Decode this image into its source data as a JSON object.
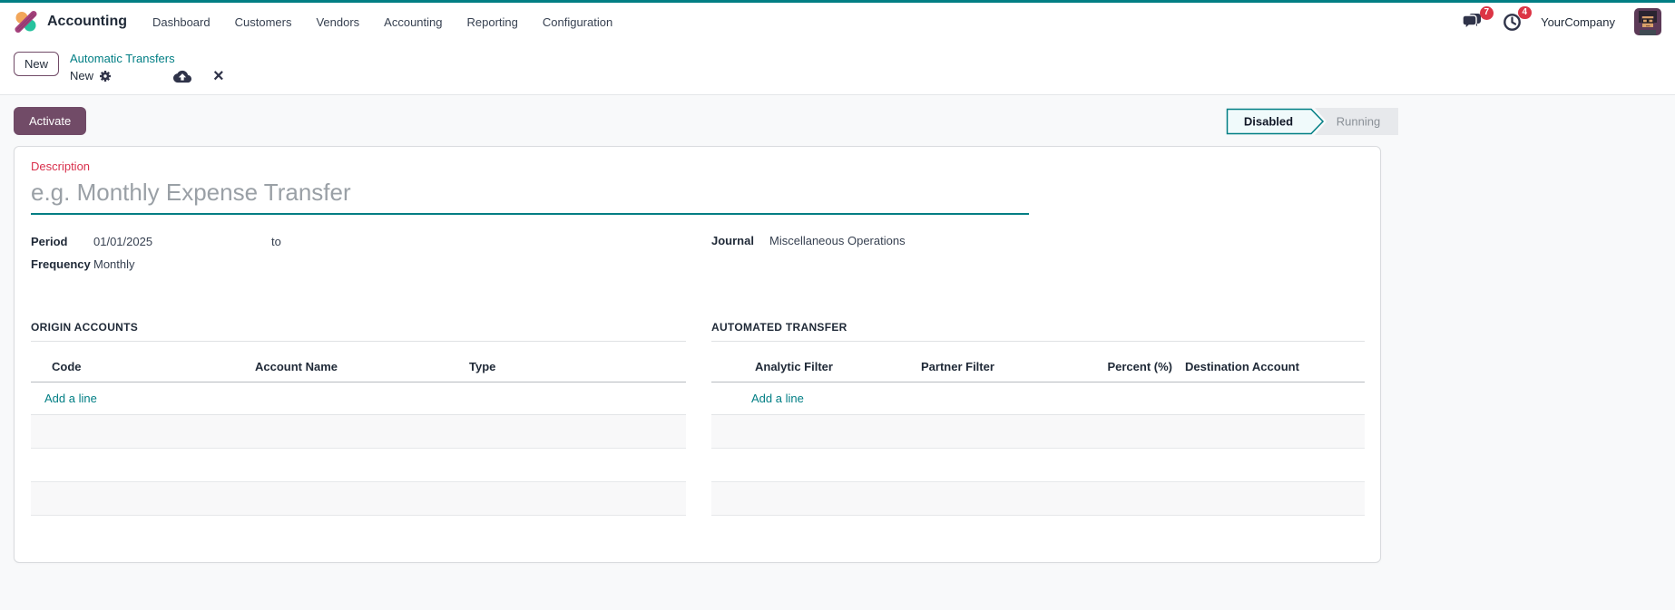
{
  "topbar": {
    "app_name": "Accounting",
    "menu": [
      "Dashboard",
      "Customers",
      "Vendors",
      "Accounting",
      "Reporting",
      "Configuration"
    ],
    "messages_badge": "7",
    "activities_badge": "4",
    "company": "YourCompany"
  },
  "breadcrumb": {
    "new_button": "New",
    "parent": "Automatic Transfers",
    "current": "New"
  },
  "statusbar": {
    "activate_button": "Activate",
    "states": [
      {
        "label": "Disabled",
        "active": true
      },
      {
        "label": "Running",
        "active": false
      }
    ]
  },
  "form": {
    "description_label": "Description",
    "description_placeholder": "e.g. Monthly Expense Transfer",
    "period_label": "Period",
    "period_start": "01/01/2025",
    "period_to_label": "to",
    "journal_label": "Journal",
    "journal_value": "Miscellaneous Operations",
    "frequency_label": "Frequency",
    "frequency_value": "Monthly"
  },
  "origin_accounts": {
    "title": "ORIGIN ACCOUNTS",
    "columns": [
      "Code",
      "Account Name",
      "Type"
    ],
    "add_line": "Add a line"
  },
  "automated_transfer": {
    "title": "AUTOMATED TRANSFER",
    "columns": [
      "Analytic Filter",
      "Partner Filter",
      "Percent (%)",
      "Destination Account"
    ],
    "add_line": "Add a line"
  },
  "colors": {
    "accent_teal": "#017e84",
    "brand_purple": "#714b67",
    "badge_red": "#dc3545",
    "invalid_label_red": "#d9304c"
  }
}
